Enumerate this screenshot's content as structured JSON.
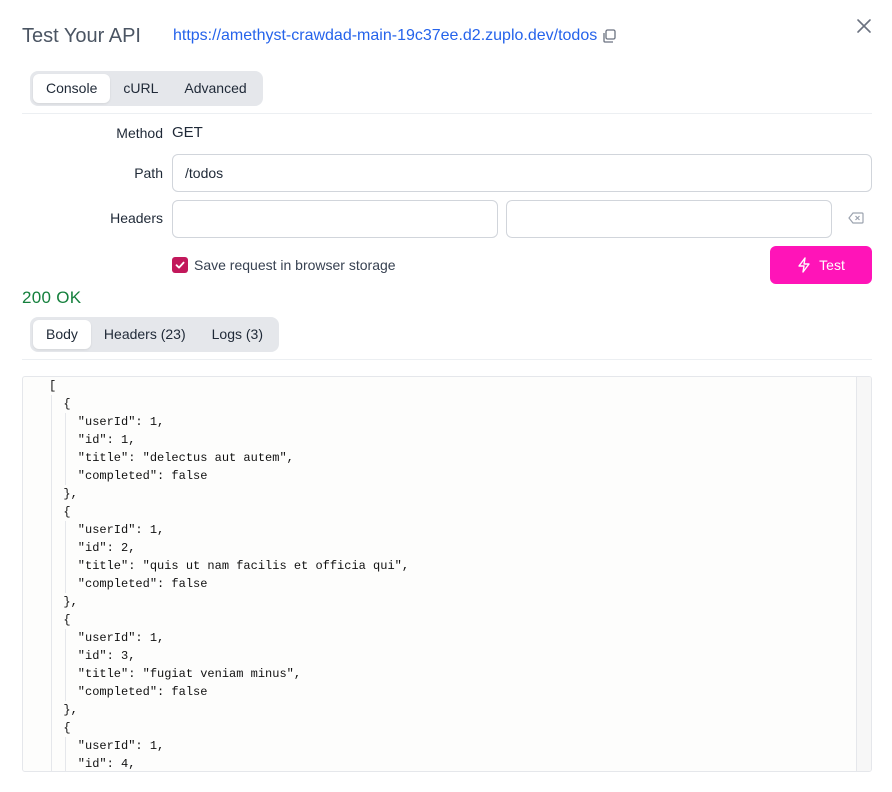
{
  "modal": {
    "title": "Test Your API",
    "url": "https://amethyst-crawdad-main-19c37ee.d2.zuplo.dev/todos"
  },
  "request_tabs": [
    {
      "label": "Console",
      "active": true
    },
    {
      "label": "cURL",
      "active": false
    },
    {
      "label": "Advanced",
      "active": false
    }
  ],
  "form": {
    "method_label": "Method",
    "method_value": "GET",
    "path_label": "Path",
    "path_value": "/todos",
    "headers_label": "Headers",
    "header_key_value": "",
    "header_val_value": "",
    "save_checkbox_label": "Save request in browser storage",
    "save_checked": true,
    "test_button_label": "Test"
  },
  "response": {
    "status": "200 OK",
    "tabs": [
      {
        "label": "Body",
        "active": true
      },
      {
        "label": "Headers (23)",
        "active": false
      },
      {
        "label": "Logs (3)",
        "active": false
      }
    ],
    "body": "[\n  {\n    \"userId\": 1,\n    \"id\": 1,\n    \"title\": \"delectus aut autem\",\n    \"completed\": false\n  },\n  {\n    \"userId\": 1,\n    \"id\": 2,\n    \"title\": \"quis ut nam facilis et officia qui\",\n    \"completed\": false\n  },\n  {\n    \"userId\": 1,\n    \"id\": 3,\n    \"title\": \"fugiat veniam minus\",\n    \"completed\": false\n  },\n  {\n    \"userId\": 1,\n    \"id\": 4,"
  },
  "colors": {
    "accent": "#ff14b8",
    "link": "#2563eb",
    "success": "#15803d",
    "checkbox": "#c2185b"
  },
  "icons": {
    "copy": "copy-icon",
    "close": "close-icon",
    "clear": "backspace-icon",
    "test": "lightning-icon",
    "check": "check-icon"
  }
}
